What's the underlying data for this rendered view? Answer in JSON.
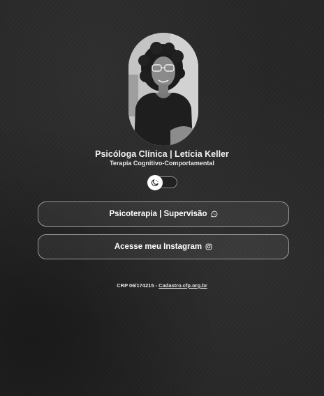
{
  "profile": {
    "name": "Psicóloga Clínica | Letícia Keller",
    "subtitle": "Terapia Cognitivo-Comportamental"
  },
  "theme_toggle": {
    "icon": "moon-icon",
    "state": "dark"
  },
  "links": [
    {
      "label": "Psicoterapia | Supervisão",
      "icon": "whatsapp-icon"
    },
    {
      "label": "Acesse meu Instagram",
      "icon": "instagram-icon"
    }
  ],
  "footer": {
    "text": "CRP 06/174215 - ",
    "link_label": "Cadastro.cfp.org.br"
  },
  "colors": {
    "background": "#272727",
    "text": "#ffffff",
    "button_border": "#9a9a9a"
  }
}
